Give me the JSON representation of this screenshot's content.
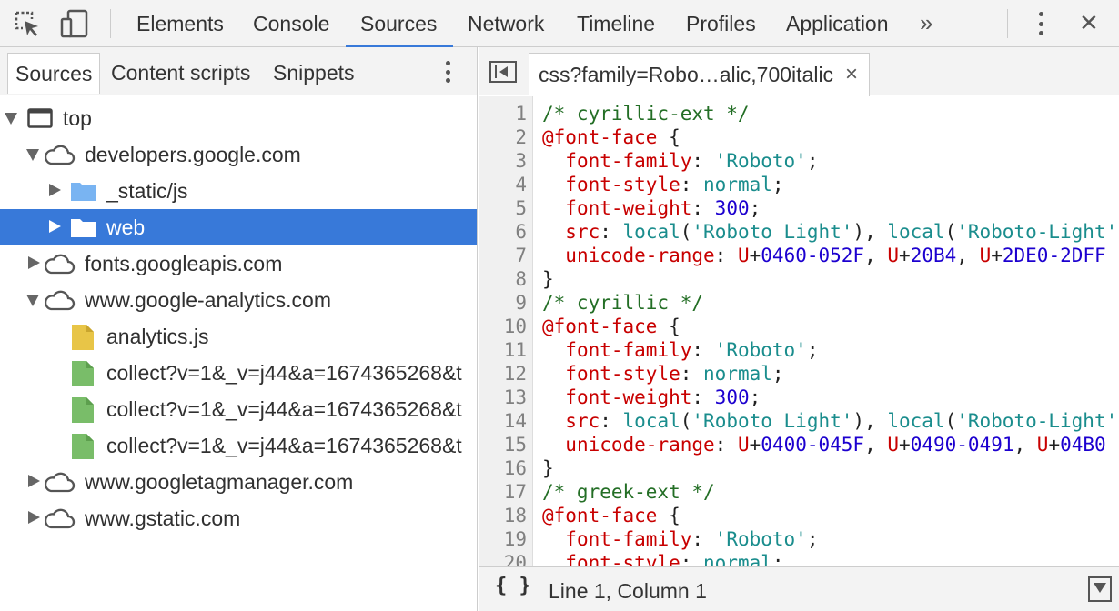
{
  "toolbar": {
    "tabs": [
      "Elements",
      "Console",
      "Sources",
      "Network",
      "Timeline",
      "Profiles",
      "Application"
    ],
    "active_tab": "Sources",
    "overflow": "»",
    "close": "✕"
  },
  "navigator": {
    "tabs": [
      "Sources",
      "Content scripts",
      "Snippets"
    ],
    "active_tab": "Sources",
    "tree": [
      {
        "label": "top",
        "icon": "frame-icon",
        "expanded": true
      },
      {
        "label": "developers.google.com",
        "icon": "cloud-icon",
        "expanded": true
      },
      {
        "label": "_static/js",
        "icon": "folder-icon",
        "expanded": false
      },
      {
        "label": "web",
        "icon": "folder-icon",
        "expanded": false,
        "selected": true
      },
      {
        "label": "fonts.googleapis.com",
        "icon": "cloud-icon",
        "expanded": false
      },
      {
        "label": "www.google-analytics.com",
        "icon": "cloud-icon",
        "expanded": true
      },
      {
        "label": "analytics.js",
        "icon": "js-file-icon"
      },
      {
        "label": "collect?v=1&_v=j44&a=1674365268&t",
        "icon": "file-icon"
      },
      {
        "label": "collect?v=1&_v=j44&a=1674365268&t",
        "icon": "file-icon"
      },
      {
        "label": "collect?v=1&_v=j44&a=1674365268&t",
        "icon": "file-icon"
      },
      {
        "label": "www.googletagmanager.com",
        "icon": "cloud-icon",
        "expanded": false
      },
      {
        "label": "www.gstatic.com",
        "icon": "cloud-icon",
        "expanded": false
      }
    ]
  },
  "editor": {
    "file_tab": "css?family=Robo…alic,700italic",
    "file_tab_close": "×",
    "line_numbers": [
      "1",
      "2",
      "3",
      "4",
      "5",
      "6",
      "7",
      "8",
      "9",
      "10",
      "11",
      "12",
      "13",
      "14",
      "15",
      "16",
      "17",
      "18",
      "19",
      "20"
    ],
    "lines": [
      [
        [
          "c-comment",
          "/* cyrillic-ext */"
        ]
      ],
      [
        [
          "c-at",
          "@font-face"
        ],
        [
          "c-plain",
          " {"
        ]
      ],
      [
        [
          "c-plain",
          "  "
        ],
        [
          "c-prop",
          "font-family"
        ],
        [
          "c-plain",
          ": "
        ],
        [
          "c-str",
          "'Roboto'"
        ],
        [
          "c-plain",
          ";"
        ]
      ],
      [
        [
          "c-plain",
          "  "
        ],
        [
          "c-prop",
          "font-style"
        ],
        [
          "c-plain",
          ": "
        ],
        [
          "c-kw",
          "normal"
        ],
        [
          "c-plain",
          ";"
        ]
      ],
      [
        [
          "c-plain",
          "  "
        ],
        [
          "c-prop",
          "font-weight"
        ],
        [
          "c-plain",
          ": "
        ],
        [
          "c-num",
          "300"
        ],
        [
          "c-plain",
          ";"
        ]
      ],
      [
        [
          "c-plain",
          "  "
        ],
        [
          "c-prop",
          "src"
        ],
        [
          "c-plain",
          ": "
        ],
        [
          "c-kw",
          "local"
        ],
        [
          "c-plain",
          "("
        ],
        [
          "c-str",
          "'Roboto Light'"
        ],
        [
          "c-plain",
          "), "
        ],
        [
          "c-kw",
          "local"
        ],
        [
          "c-plain",
          "("
        ],
        [
          "c-str",
          "'Roboto-Light'"
        ]
      ],
      [
        [
          "c-plain",
          "  "
        ],
        [
          "c-prop",
          "unicode-range"
        ],
        [
          "c-plain",
          ": "
        ],
        [
          "c-prop",
          "U"
        ],
        [
          "c-plain",
          "+"
        ],
        [
          "c-num",
          "0460-052F"
        ],
        [
          "c-plain",
          ", "
        ],
        [
          "c-prop",
          "U"
        ],
        [
          "c-plain",
          "+"
        ],
        [
          "c-num",
          "20B4"
        ],
        [
          "c-plain",
          ", "
        ],
        [
          "c-prop",
          "U"
        ],
        [
          "c-plain",
          "+"
        ],
        [
          "c-num",
          "2DE0-2DFF"
        ]
      ],
      [
        [
          "c-plain",
          "}"
        ]
      ],
      [
        [
          "c-comment",
          "/* cyrillic */"
        ]
      ],
      [
        [
          "c-at",
          "@font-face"
        ],
        [
          "c-plain",
          " {"
        ]
      ],
      [
        [
          "c-plain",
          "  "
        ],
        [
          "c-prop",
          "font-family"
        ],
        [
          "c-plain",
          ": "
        ],
        [
          "c-str",
          "'Roboto'"
        ],
        [
          "c-plain",
          ";"
        ]
      ],
      [
        [
          "c-plain",
          "  "
        ],
        [
          "c-prop",
          "font-style"
        ],
        [
          "c-plain",
          ": "
        ],
        [
          "c-kw",
          "normal"
        ],
        [
          "c-plain",
          ";"
        ]
      ],
      [
        [
          "c-plain",
          "  "
        ],
        [
          "c-prop",
          "font-weight"
        ],
        [
          "c-plain",
          ": "
        ],
        [
          "c-num",
          "300"
        ],
        [
          "c-plain",
          ";"
        ]
      ],
      [
        [
          "c-plain",
          "  "
        ],
        [
          "c-prop",
          "src"
        ],
        [
          "c-plain",
          ": "
        ],
        [
          "c-kw",
          "local"
        ],
        [
          "c-plain",
          "("
        ],
        [
          "c-str",
          "'Roboto Light'"
        ],
        [
          "c-plain",
          "), "
        ],
        [
          "c-kw",
          "local"
        ],
        [
          "c-plain",
          "("
        ],
        [
          "c-str",
          "'Roboto-Light'"
        ]
      ],
      [
        [
          "c-plain",
          "  "
        ],
        [
          "c-prop",
          "unicode-range"
        ],
        [
          "c-plain",
          ": "
        ],
        [
          "c-prop",
          "U"
        ],
        [
          "c-plain",
          "+"
        ],
        [
          "c-num",
          "0400-045F"
        ],
        [
          "c-plain",
          ", "
        ],
        [
          "c-prop",
          "U"
        ],
        [
          "c-plain",
          "+"
        ],
        [
          "c-num",
          "0490-0491"
        ],
        [
          "c-plain",
          ", "
        ],
        [
          "c-prop",
          "U"
        ],
        [
          "c-plain",
          "+"
        ],
        [
          "c-num",
          "04B0"
        ]
      ],
      [
        [
          "c-plain",
          "}"
        ]
      ],
      [
        [
          "c-comment",
          "/* greek-ext */"
        ]
      ],
      [
        [
          "c-at",
          "@font-face"
        ],
        [
          "c-plain",
          " {"
        ]
      ],
      [
        [
          "c-plain",
          "  "
        ],
        [
          "c-prop",
          "font-family"
        ],
        [
          "c-plain",
          ": "
        ],
        [
          "c-str",
          "'Roboto'"
        ],
        [
          "c-plain",
          ";"
        ]
      ],
      [
        [
          "c-plain",
          "  "
        ],
        [
          "c-prop",
          "font-style"
        ],
        [
          "c-plain",
          ": "
        ],
        [
          "c-kw",
          "normal"
        ],
        [
          "c-plain",
          ";"
        ]
      ]
    ],
    "status": "Line 1, Column 1",
    "pretty_print": "{ }"
  },
  "colors": {
    "selection": "#3879d9",
    "toolbar_bg": "#f3f3f3",
    "folder_light": "#79b4f2",
    "js_file": "#e8c547",
    "generic_file": "#79bd69"
  }
}
